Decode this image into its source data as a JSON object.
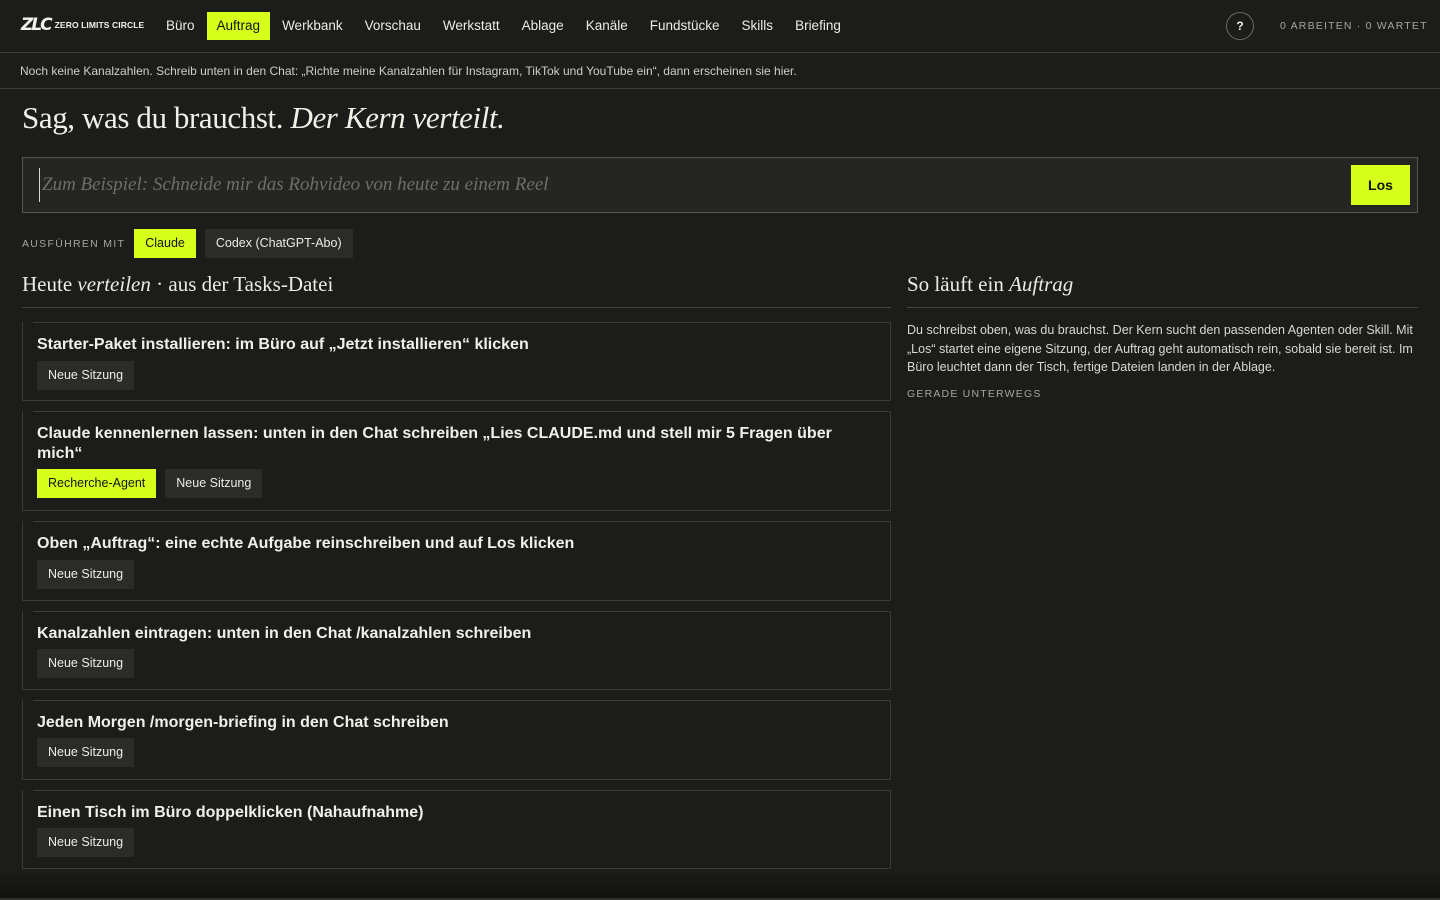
{
  "brand": {
    "mark": "ZLC",
    "name": "ZERO LIMITS CIRCLE"
  },
  "nav": [
    {
      "label": "Büro",
      "active": false
    },
    {
      "label": "Auftrag",
      "active": true
    },
    {
      "label": "Werkbank",
      "active": false
    },
    {
      "label": "Vorschau",
      "active": false
    },
    {
      "label": "Werkstatt",
      "active": false
    },
    {
      "label": "Ablage",
      "active": false
    },
    {
      "label": "Kanäle",
      "active": false
    },
    {
      "label": "Fundstücke",
      "active": false
    },
    {
      "label": "Skills",
      "active": false
    },
    {
      "label": "Briefing",
      "active": false
    }
  ],
  "help_label": "?",
  "status": "0 ARBEITEN · 0 WARTET",
  "info": "Noch keine Kanalzahlen. Schreib unten in den Chat: „Richte meine Kanalzahlen für Instagram, TikTok und YouTube ein“, dann erscheinen sie hier.",
  "headline": {
    "plain": "Sag, was du brauchst.",
    "italic": "Der Kern verteilt."
  },
  "prompt": {
    "placeholder": "Zum Beispiel: Schneide mir das Rohvideo von heute zu einem Reel",
    "value": "",
    "submit": "Los"
  },
  "runwith": {
    "label": "AUSFÜHREN MIT",
    "options": [
      {
        "label": "Claude",
        "active": true
      },
      {
        "label": "Codex (ChatGPT-Abo)",
        "active": false
      }
    ]
  },
  "today": {
    "pre": "Heute",
    "italic": "verteilen",
    "post": "· aus der Tasks-Datei"
  },
  "tasks": [
    {
      "title": "Starter-Paket installieren: im Büro auf „Jetzt installieren“ klicken",
      "agent": "",
      "session": "Neue Sitzung"
    },
    {
      "title": "Claude kennenlernen lassen: unten in den Chat schreiben „Lies CLAUDE.md und stell mir 5 Fragen über mich“",
      "agent": "Recherche-Agent",
      "session": "Neue Sitzung"
    },
    {
      "title": "Oben „Auftrag“: eine echte Aufgabe reinschreiben und auf Los klicken",
      "agent": "",
      "session": "Neue Sitzung"
    },
    {
      "title": "Kanalzahlen eintragen: unten in den Chat /kanalzahlen schreiben",
      "agent": "",
      "session": "Neue Sitzung"
    },
    {
      "title": "Jeden Morgen /morgen-briefing in den Chat schreiben",
      "agent": "",
      "session": "Neue Sitzung"
    },
    {
      "title": "Einen Tisch im Büro doppelklicken (Nahaufnahme)",
      "agent": "",
      "session": "Neue Sitzung"
    }
  ],
  "howto": {
    "pre": "So läuft ein",
    "italic": "Auftrag",
    "text": "Du schreibst oben, was du brauchst. Der Kern sucht den passenden Agenten oder Skill. Mit „Los“ startet eine eigene Sitzung, der Auftrag geht automatisch rein, sobald sie bereit ist. Im Büro leuchtet dann der Tisch, fertige Dateien landen in der Ablage.",
    "underway": "GERADE UNTERWEGS"
  }
}
